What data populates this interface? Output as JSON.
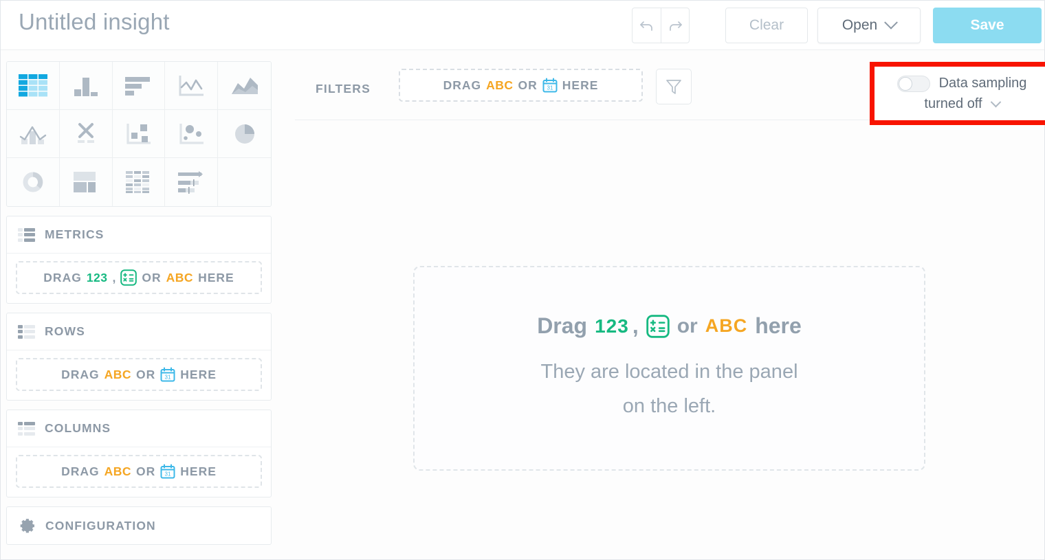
{
  "header": {
    "title": "Untitled insight",
    "undo_icon": "undo-arrow-icon",
    "redo_icon": "redo-arrow-icon",
    "clear_label": "Clear",
    "open_label": "Open",
    "open_chevron_icon": "chevron-down-icon",
    "save_label": "Save",
    "save_bg_color": "#8cdcf1",
    "title_color": "#9aa7b4"
  },
  "viz_types": [
    {
      "name": "pivot-table",
      "icon": "table-grid-icon",
      "selected": true
    },
    {
      "name": "column-chart",
      "icon": "bar-column-icon",
      "selected": false
    },
    {
      "name": "bar-chart",
      "icon": "horizontal-bar-icon",
      "selected": false
    },
    {
      "name": "line-chart",
      "icon": "line-chart-icon",
      "selected": false
    },
    {
      "name": "area-chart",
      "icon": "area-chart-icon",
      "selected": false
    },
    {
      "name": "combo-chart",
      "icon": "combo-line-column-icon",
      "selected": false
    },
    {
      "name": "scatter-x-chart",
      "icon": "x-marker-icon",
      "selected": false
    },
    {
      "name": "treemap-chart",
      "icon": "squares-scatter-icon",
      "selected": false
    },
    {
      "name": "bubble-chart",
      "icon": "bubble-scatter-icon",
      "selected": false
    },
    {
      "name": "pie-chart",
      "icon": "pie-slice-icon",
      "selected": false
    },
    {
      "name": "donut-chart",
      "icon": "donut-ring-icon",
      "selected": false
    },
    {
      "name": "dashboard-layout",
      "icon": "layout-blocks-icon",
      "selected": false
    },
    {
      "name": "data-table",
      "icon": "dense-table-icon",
      "selected": false
    },
    {
      "name": "bullet-chart",
      "icon": "progress-bars-icon",
      "selected": false
    },
    {
      "name": "empty-slot",
      "icon": "",
      "selected": false
    }
  ],
  "sections": [
    {
      "id": "metrics",
      "title": "METRICS",
      "icon": "metrics-list-icon",
      "dropzone": {
        "drag": "DRAG",
        "numeric": "123",
        "comma": ",",
        "calc_icon": "calculator-measure-icon",
        "or": "OR",
        "text": "ABC",
        "here": "HERE"
      }
    },
    {
      "id": "rows",
      "title": "ROWS",
      "icon": "rows-list-icon",
      "dropzone": {
        "drag": "DRAG",
        "text": "ABC",
        "or": "OR",
        "date_icon": "calendar-31-icon",
        "here": "HERE"
      }
    },
    {
      "id": "columns",
      "title": "COLUMNS",
      "icon": "columns-list-icon",
      "dropzone": {
        "drag": "DRAG",
        "text": "ABC",
        "or": "OR",
        "date_icon": "calendar-31-icon",
        "here": "HERE"
      }
    },
    {
      "id": "configuration",
      "title": "CONFIGURATION",
      "icon": "gear-icon"
    }
  ],
  "filters": {
    "label": "FILTERS",
    "dropzone": {
      "drag": "DRAG",
      "text": "ABC",
      "or": "OR",
      "date_icon": "calendar-31-icon",
      "here": "HERE"
    },
    "filter_button_icon": "funnel-filter-icon"
  },
  "data_sampling": {
    "toggle_state": "off",
    "line1": "Data sampling",
    "line2": "turned off",
    "chevron_icon": "chevron-down-icon",
    "highlight_color": "#f81400",
    "highlighted": true
  },
  "canvas": {
    "drop_message": {
      "drag": "Drag",
      "numeric": "123",
      "comma": ",",
      "calc_icon": "calculator-measure-icon",
      "or": "or",
      "text": "ABC",
      "here": "here"
    },
    "hint_line1": "They are located in the panel",
    "hint_line2": "on the left."
  },
  "colors": {
    "numeric_green": "#16b981",
    "text_orange": "#f5a623",
    "date_blue": "#3cb8e8",
    "muted_gray": "#8d99a6",
    "selected_blue": "#12a8e0"
  }
}
